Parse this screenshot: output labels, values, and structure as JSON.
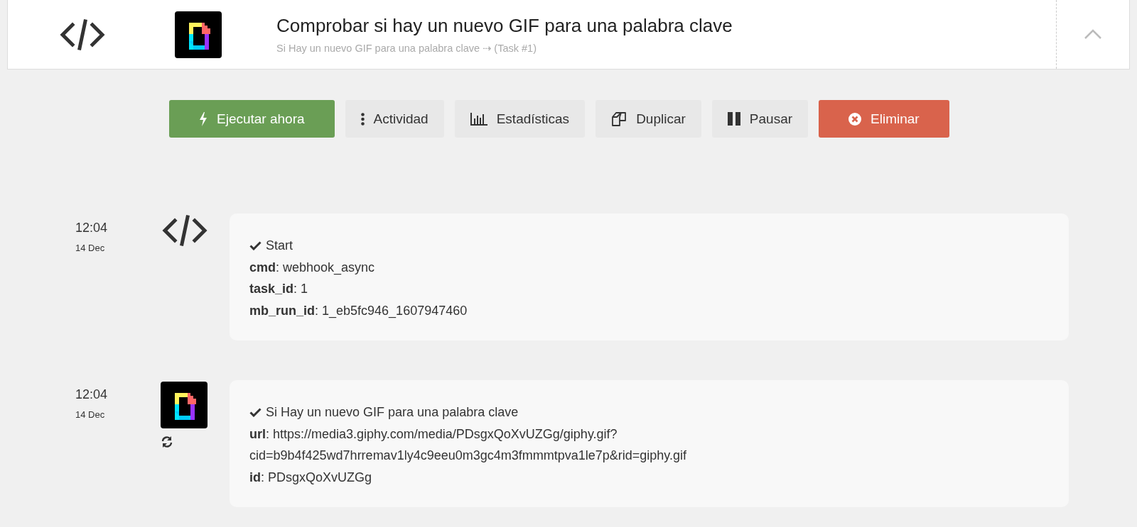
{
  "header": {
    "title": "Comprobar si hay un nuevo GIF para una palabra clave",
    "subtitle": "Si Hay un nuevo GIF para una palabra clave ⇢ (Task #1)",
    "expanded": true
  },
  "actions": [
    {
      "kind": "run",
      "label": "Ejecutar ahora"
    },
    {
      "kind": "activity",
      "label": "Actividad"
    },
    {
      "kind": "stats",
      "label": "Estadísticas"
    },
    {
      "kind": "duplicate",
      "label": "Duplicar"
    },
    {
      "kind": "pause",
      "label": "Pausar"
    },
    {
      "kind": "delete",
      "label": "Eliminar"
    }
  ],
  "entries": [
    {
      "time": "12:04",
      "date": "14 Dec",
      "kind": "code",
      "retried": false,
      "heading": "Start",
      "fields": [
        "**cmd**: webhook_async",
        "**task_id**: 1",
        "**mb_run_id**: 1_eb5fc946_1607947460"
      ]
    },
    {
      "time": "12:04",
      "date": "14 Dec",
      "kind": "giphy",
      "retried": true,
      "heading": "Si Hay un nuevo GIF para una palabra clave",
      "fields": [
        "**url**: https://media3.giphy.com/media/PDsgxQoXvUZGg/giphy.gif?cid=b9b4f425wd7hrremav1ly4c9eeu0m3gc4m3fmmmtpva1le7p&rid=giphy.gif",
        "**id**: PDsgxQoXvUZGg"
      ]
    }
  ]
}
